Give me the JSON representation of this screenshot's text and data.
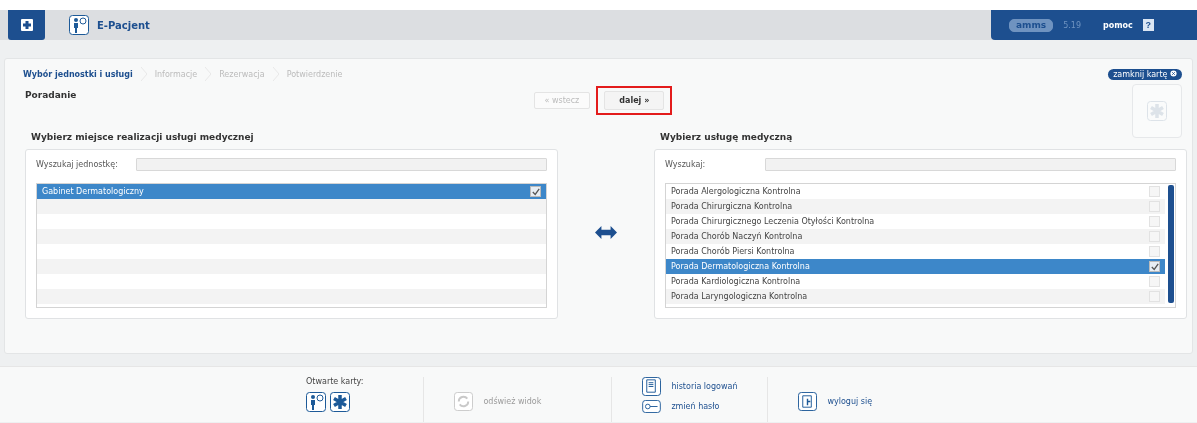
{
  "header": {
    "app_title": "E-Pacjent",
    "logo": "amms",
    "version": "5.19",
    "help_link": "pomoc",
    "help_button": "?"
  },
  "steps": [
    {
      "label": "Wybór jednostki i usługi",
      "selected": true
    },
    {
      "label": "Informacje",
      "selected": false
    },
    {
      "label": "Rezerwacja",
      "selected": false
    },
    {
      "label": "Potwierdzenie",
      "selected": false
    }
  ],
  "close_tab_button": "zamknij kartę",
  "page_title": "Poradanie",
  "nav": [
    {
      "label": "« wstecz",
      "disabled": true,
      "highlighted": false
    },
    {
      "label": "dalej »",
      "disabled": false,
      "highlighted": true
    }
  ],
  "units_panel": {
    "title": "Wybierz miejsce realizacji usługi medycznej",
    "search_label": "Wyszukaj jednostkę:",
    "items": [
      {
        "label": "Gabinet Dermatologiczny",
        "selected": true,
        "checked": true
      }
    ]
  },
  "services_panel": {
    "title": "Wybierz usługę medyczną",
    "search_label": "Wyszukaj:",
    "items": [
      {
        "label": "Porada Alergologiczna Kontrolna",
        "selected": false,
        "checked": false
      },
      {
        "label": "Porada Chirurgiczna Kontrolna",
        "selected": false,
        "checked": false
      },
      {
        "label": "Porada Chirurgicznego Leczenia Otyłości Kontrolna",
        "selected": false,
        "checked": false
      },
      {
        "label": "Porada Chorób Naczyń Kontrolna",
        "selected": false,
        "checked": false
      },
      {
        "label": "Porada Chorób Piersi Kontrolna",
        "selected": false,
        "checked": false
      },
      {
        "label": "Porada Dermatologiczna Kontrolna",
        "selected": true,
        "checked": true
      },
      {
        "label": "Porada Kardiologiczna Kontrolna",
        "selected": false,
        "checked": false
      },
      {
        "label": "Porada Laryngologiczna Kontrolna",
        "selected": false,
        "checked": false
      }
    ]
  },
  "footer": {
    "open_tabs_label": "Otwarte karty:",
    "actions": [
      {
        "label": "odśwież widok",
        "kind": "refresh",
        "disabled": true
      },
      {
        "label": "historia logowań",
        "kind": "history",
        "disabled": false
      },
      {
        "label": "zmień hasło",
        "kind": "key",
        "disabled": false
      },
      {
        "label": "wyloguj się",
        "kind": "logout",
        "disabled": false
      }
    ]
  }
}
